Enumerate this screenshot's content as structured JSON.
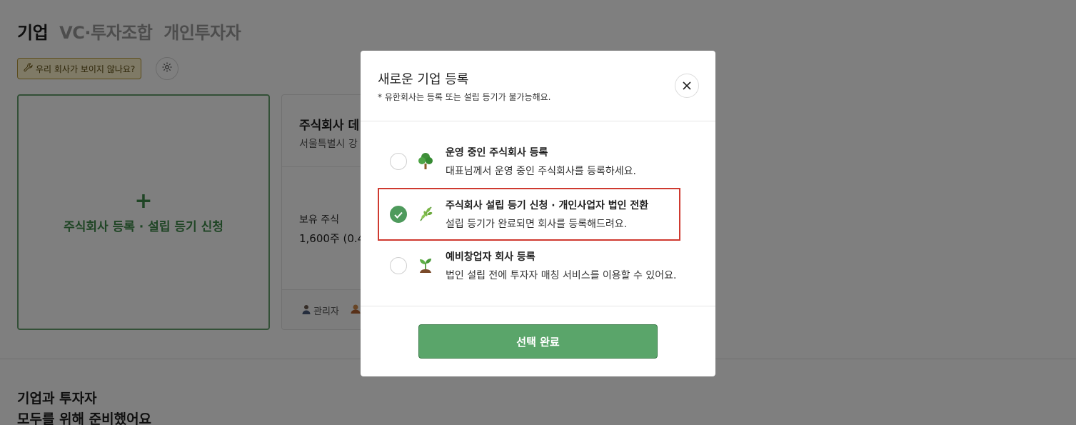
{
  "tabs": [
    {
      "label": "기업",
      "active": true
    },
    {
      "label": "VC·투자조합",
      "active": false
    },
    {
      "label": "개인투자자",
      "active": false
    }
  ],
  "help_button": {
    "label": "우리 회사가 보이지 않나요?",
    "icon": "wrench-icon"
  },
  "settings_button": {
    "icon": "gear-icon"
  },
  "add_card": {
    "plus": "+",
    "label": "주식회사 등록 · 설립 등기 신청"
  },
  "company_card": {
    "name": "주식회사 데",
    "address": "서울특별시 강",
    "stock_label": "보유 주식",
    "stock_value": "1,600주 (0.4",
    "role": "관리자"
  },
  "bottom": {
    "line1": "기업과 투자자",
    "line2": "모두를 위해 준비했어요"
  },
  "modal": {
    "title": "새로운 기업 등록",
    "subtitle": "* 유한회사는 등록 또는 설립 등기가 불가능해요.",
    "options": [
      {
        "title": "운영 중인 주식회사 등록",
        "desc": "대표님께서 운영 중인 주식회사를 등록하세요.",
        "icon": "tree-icon",
        "selected": false
      },
      {
        "title": "주식회사 설립 등기 신청 · 개인사업자 법인 전환",
        "desc": "설립 등기가 완료되면 회사를 등록해드려요.",
        "icon": "herb-icon",
        "selected": true
      },
      {
        "title": "예비창업자 회사 등록",
        "desc": "법인 설립 전에 투자자 매칭 서비스를 이용할 수 있어요.",
        "icon": "seedling-icon",
        "selected": false
      }
    ],
    "confirm_label": "선택 완료"
  },
  "colors": {
    "accent_green": "#5aa56a",
    "highlight_red": "#cf3a30"
  }
}
